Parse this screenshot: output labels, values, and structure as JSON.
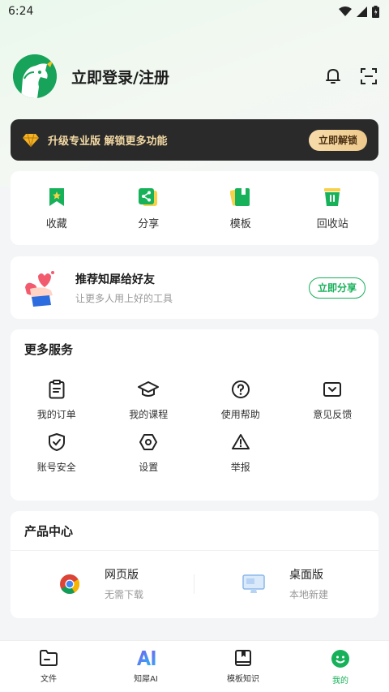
{
  "status_bar": {
    "time": "6:24"
  },
  "header": {
    "login_text": "立即登录/注册"
  },
  "pro_banner": {
    "text": "升级专业版 解锁更多功能",
    "button": "立即解锁"
  },
  "quick_actions": [
    {
      "label": "收藏",
      "icon": "bookmark-icon"
    },
    {
      "label": "分享",
      "icon": "share-icon"
    },
    {
      "label": "模板",
      "icon": "template-icon"
    },
    {
      "label": "回收站",
      "icon": "trash-icon"
    }
  ],
  "share_card": {
    "title": "推荐知犀给好友",
    "subtitle": "让更多人用上好的工具",
    "button": "立即分享"
  },
  "services": {
    "title": "更多服务",
    "items": [
      {
        "label": "我的订单",
        "icon": "order-icon"
      },
      {
        "label": "我的课程",
        "icon": "course-icon"
      },
      {
        "label": "使用帮助",
        "icon": "help-icon"
      },
      {
        "label": "意见反馈",
        "icon": "feedback-icon"
      },
      {
        "label": "账号安全",
        "icon": "shield-icon"
      },
      {
        "label": "设置",
        "icon": "settings-icon"
      },
      {
        "label": "举报",
        "icon": "report-icon"
      }
    ]
  },
  "products": {
    "title": "产品中心",
    "web": {
      "title": "网页版",
      "subtitle": "无需下载"
    },
    "desktop": {
      "title": "桌面版",
      "subtitle": "本地新建"
    }
  },
  "tabs": [
    {
      "label": "文件",
      "icon": "folder-icon"
    },
    {
      "label": "知犀AI",
      "icon": "ai-icon"
    },
    {
      "label": "模板知识",
      "icon": "book-icon"
    },
    {
      "label": "我的",
      "icon": "smile-icon",
      "active": true
    }
  ],
  "colors": {
    "accent": "#17b15a",
    "banner_bg": "#2a2a2a",
    "banner_text": "#f3d9a4"
  }
}
